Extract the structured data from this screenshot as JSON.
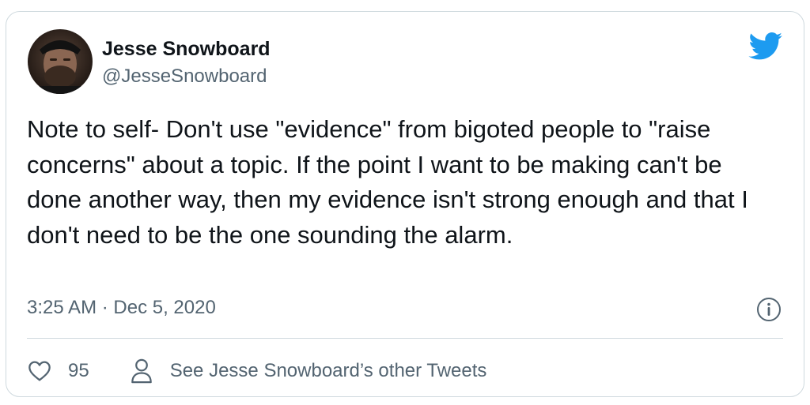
{
  "author": {
    "name": "Jesse Snowboard",
    "handle": "@JesseSnowboard",
    "avatar_icon": "user-avatar-photo"
  },
  "tweet": {
    "text": "Note to self- Don't use \"evidence\" from bigoted people to \"raise concerns\" about a topic. If the point I want to be making can't be done another way, then my evidence isn't strong enough and that I don't need to be the one sounding the alarm.",
    "timestamp": "3:25 AM · Dec 5, 2020"
  },
  "actions": {
    "like_count": "95",
    "like_icon": "heart-icon",
    "other_tweets_label": "See Jesse Snowboard’s other Tweets",
    "other_tweets_icon": "person-icon"
  },
  "icons": {
    "brand": "twitter-bird-icon",
    "info": "info-icon"
  },
  "colors": {
    "brand_blue": "#1d9bf0",
    "text_primary": "#0f1419",
    "text_secondary": "#536471",
    "border": "#cfd9de"
  }
}
